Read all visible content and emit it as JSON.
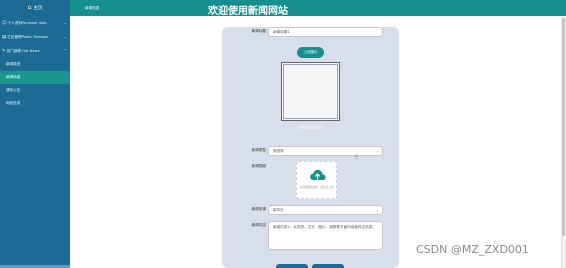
{
  "sidebar": {
    "home_label": "主页",
    "items": [
      {
        "label": "个人资料Personal data"
      },
      {
        "label": "栏目管理Public Manage"
      },
      {
        "label": "热门新闻 Hot News"
      }
    ],
    "subitems": [
      {
        "label": "新闻类型"
      },
      {
        "label": "新闻信息"
      },
      {
        "label": "通知公告"
      },
      {
        "label": "网站信息"
      }
    ]
  },
  "header": {
    "tab": "新闻信息",
    "title": "欢迎使用新闻网站"
  },
  "form": {
    "title_label": "新闻标题",
    "title_value": "新闻标题1",
    "upload_button": "上传图片",
    "type_label": "新闻类型",
    "type_value": "请选择",
    "video_label": "新闻视频",
    "uploader_text": "将视频拖到此处，或点击上传",
    "source_label": "新闻来源",
    "source_value": "新华社",
    "content_label": "新闻内容",
    "content_value": "新闻内容1，从视觉、文字、图片、视频等方面向读者传达信息。"
  },
  "watermark": "CSDN @MZ_ZXD001",
  "colors": {
    "sidebar": "#1c6b94",
    "header": "#16908f",
    "active": "#1b968d",
    "panel": "#d6dfea"
  }
}
